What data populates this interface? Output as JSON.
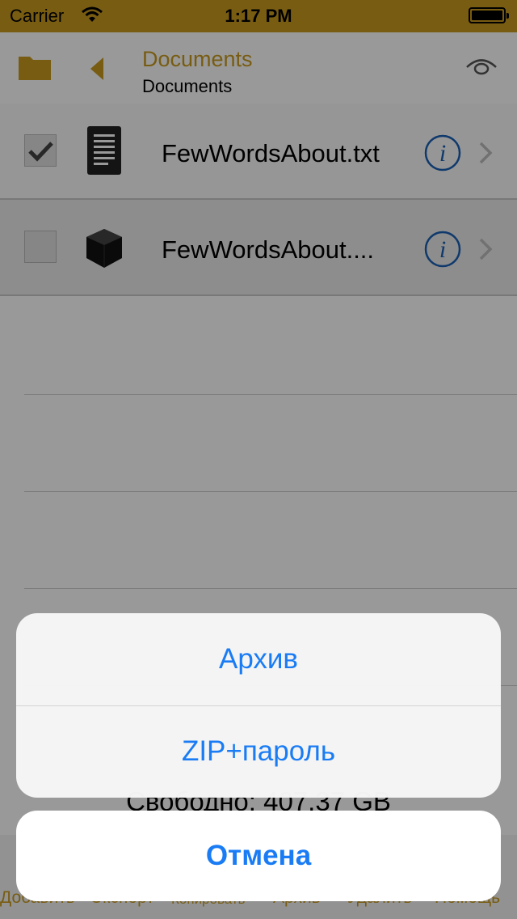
{
  "status_bar": {
    "carrier": "Carrier",
    "time": "1:17 PM"
  },
  "nav": {
    "title": "Documents",
    "subtitle": "Documents"
  },
  "files": [
    {
      "name": "FewWordsAbout.txt",
      "checked": true,
      "icon": "text-document-icon"
    },
    {
      "name": "FewWordsAbout....",
      "checked": false,
      "icon": "archive-box-icon"
    }
  ],
  "free_space": "Свободно: 407.37 GB",
  "toolbar": {
    "add": "Добавить",
    "export": "Экспорт",
    "copy": "Копировать",
    "archive": "Архив",
    "delete": "Удалить",
    "help": "Помощь"
  },
  "action_sheet": {
    "option_archive": "Архив",
    "option_zip_password": "ZIP+пароль",
    "cancel": "Отмена"
  },
  "colors": {
    "accent": "#c89a1e",
    "action_blue": "#1a7cf5",
    "info_blue": "#1a5fb4"
  }
}
